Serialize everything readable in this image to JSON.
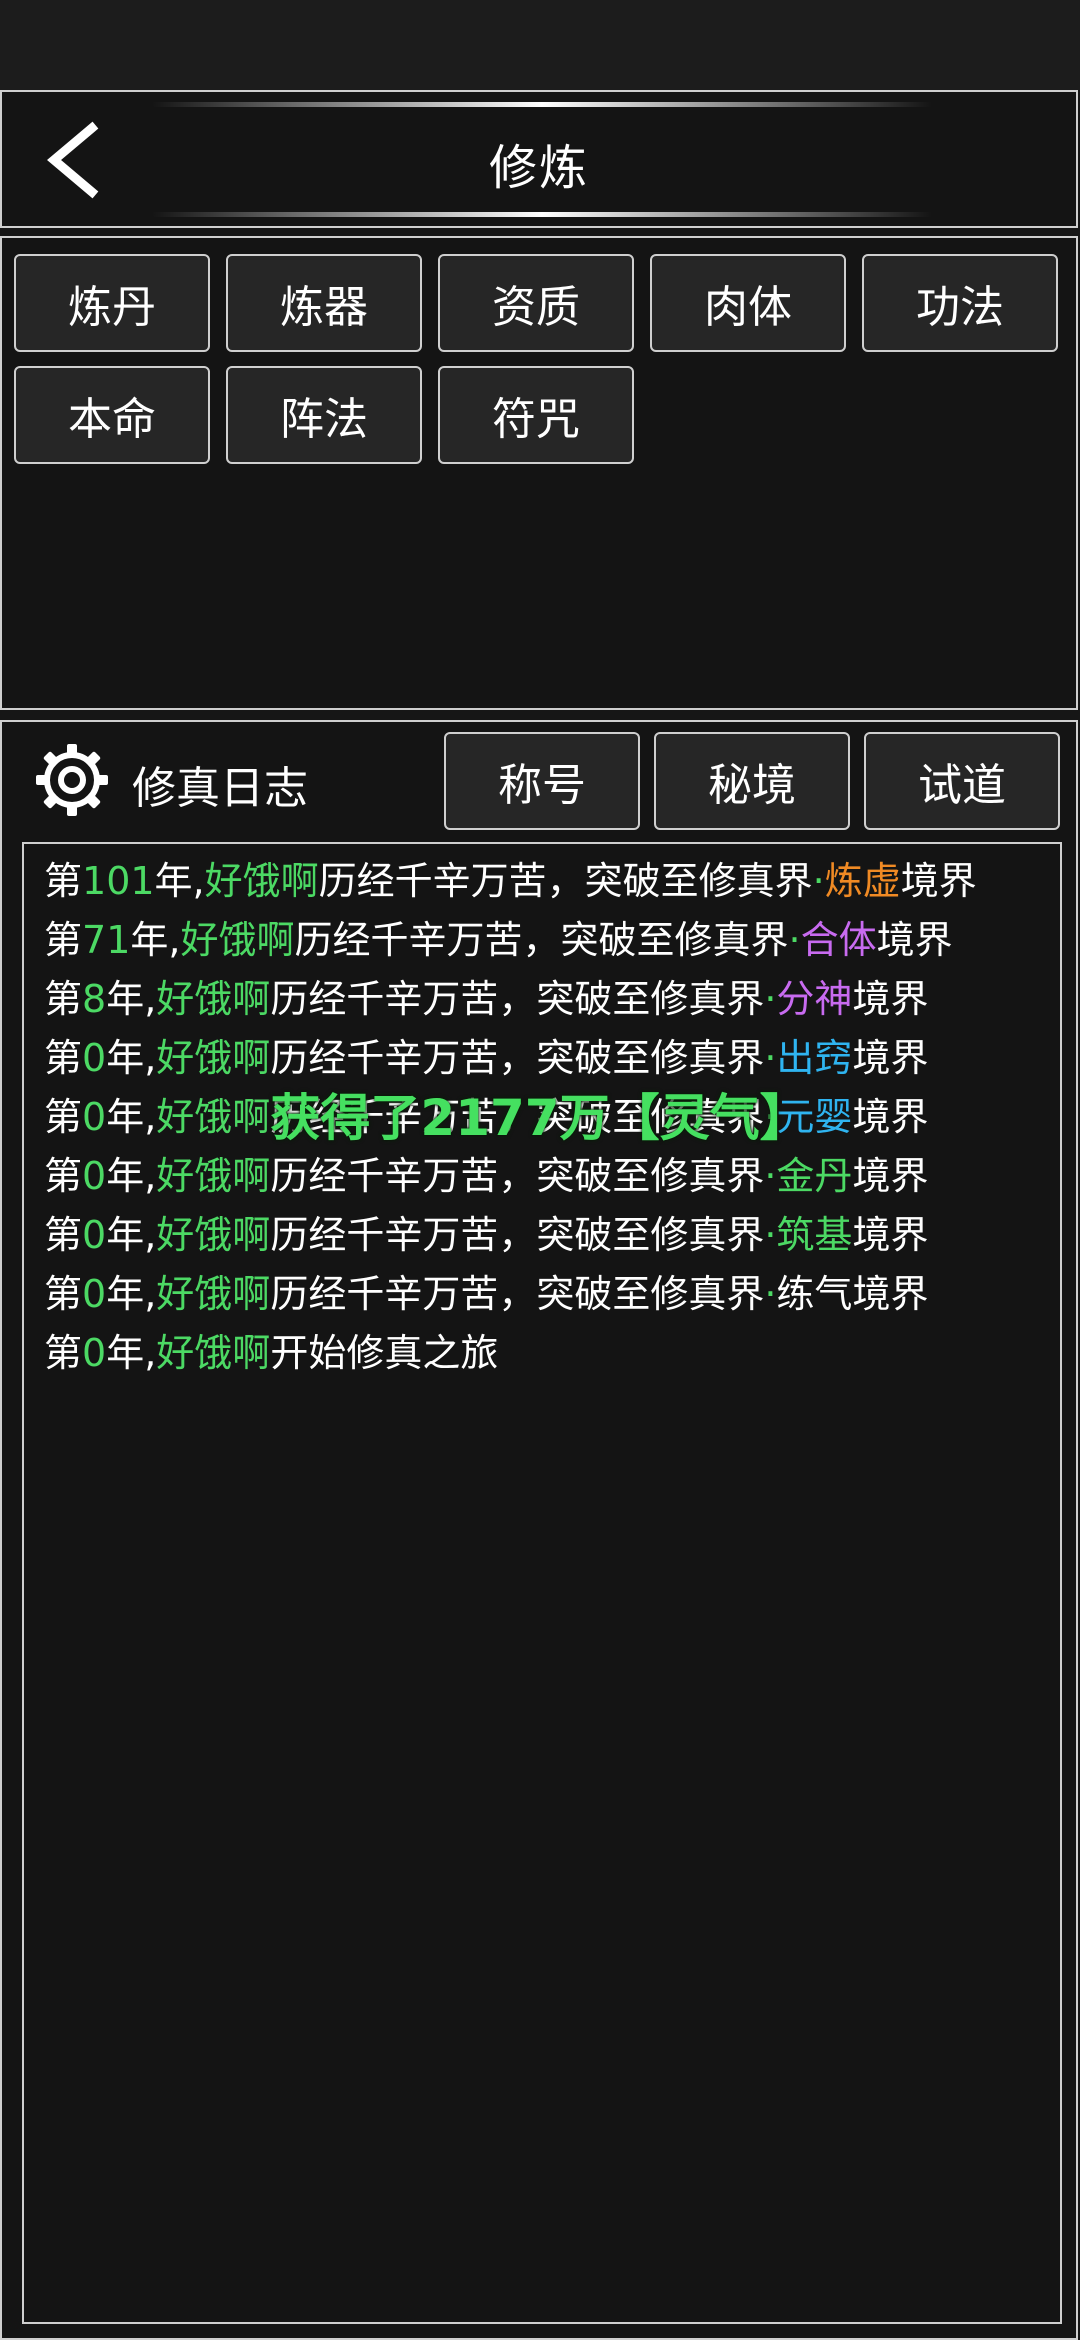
{
  "header": {
    "title": "修炼",
    "back_icon": "chevron-left-icon"
  },
  "tabs": [
    {
      "label": "炼丹"
    },
    {
      "label": "炼器"
    },
    {
      "label": "资质"
    },
    {
      "label": "肉体"
    },
    {
      "label": "功法"
    },
    {
      "label": "本命"
    },
    {
      "label": "阵法"
    },
    {
      "label": "符咒"
    }
  ],
  "log": {
    "icon": "gear-icon",
    "title": "修真日志",
    "buttons": [
      {
        "label": "称号"
      },
      {
        "label": "秘境"
      },
      {
        "label": "试道"
      }
    ],
    "lines": [
      {
        "prefix": "第",
        "year": "101",
        "yr": "年,",
        "name": "好饿啊",
        "text": "历经千辛万苦，突破至修真界",
        "dot": "·",
        "realm": "炼虚",
        "realm_color": "#f08a24",
        "suffix": "境界"
      },
      {
        "prefix": "第",
        "year": "71",
        "yr": "年,",
        "name": "好饿啊",
        "text": "历经千辛万苦，突破至修真界",
        "dot": "·",
        "realm": "合体",
        "realm_color": "#c86bf0",
        "suffix": "境界"
      },
      {
        "prefix": "第",
        "year": "8",
        "yr": "年,",
        "name": "好饿啊",
        "text": "历经千辛万苦，突破至修真界",
        "dot": "·",
        "realm": "分神",
        "realm_color": "#c86bf0",
        "suffix": "境界"
      },
      {
        "prefix": "第",
        "year": "0",
        "yr": "年,",
        "name": "好饿啊",
        "text": "历经千辛万苦，突破至修真界",
        "dot": "·",
        "realm": "出窍",
        "realm_color": "#2fb4f0",
        "suffix": "境界"
      },
      {
        "prefix": "第",
        "year": "0",
        "yr": "年,",
        "name": "好饿啊",
        "text": "历经千辛万苦，突破至修真界",
        "dot": "·",
        "realm": "元婴",
        "realm_color": "#2fb4f0",
        "suffix": "境界"
      },
      {
        "prefix": "第",
        "year": "0",
        "yr": "年,",
        "name": "好饿啊",
        "text": "历经千辛万苦，突破至修真界",
        "dot": "·",
        "realm": "金丹",
        "realm_color": "#4cd964",
        "suffix": "境界"
      },
      {
        "prefix": "第",
        "year": "0",
        "yr": "年,",
        "name": "好饿啊",
        "text": "历经千辛万苦，突破至修真界",
        "dot": "·",
        "realm": "筑基",
        "realm_color": "#4cd964",
        "suffix": "境界"
      },
      {
        "prefix": "第",
        "year": "0",
        "yr": "年,",
        "name": "好饿啊",
        "text": "历经千辛万苦，突破至修真界",
        "dot": "·",
        "realm": "练气",
        "realm_color": "#ffffff",
        "suffix": "境界"
      },
      {
        "prefix": "第",
        "year": "0",
        "yr": "年,",
        "name": "好饿啊",
        "text": "开始修真之旅",
        "dot": "",
        "realm": "",
        "realm_color": "#ffffff",
        "suffix": ""
      }
    ]
  },
  "toast": {
    "text": "获得了2177万【灵气】",
    "color": "#45e060"
  },
  "colors": {
    "highlight": "#4cd964",
    "border": "#cfcfcf",
    "background": "#141414"
  }
}
